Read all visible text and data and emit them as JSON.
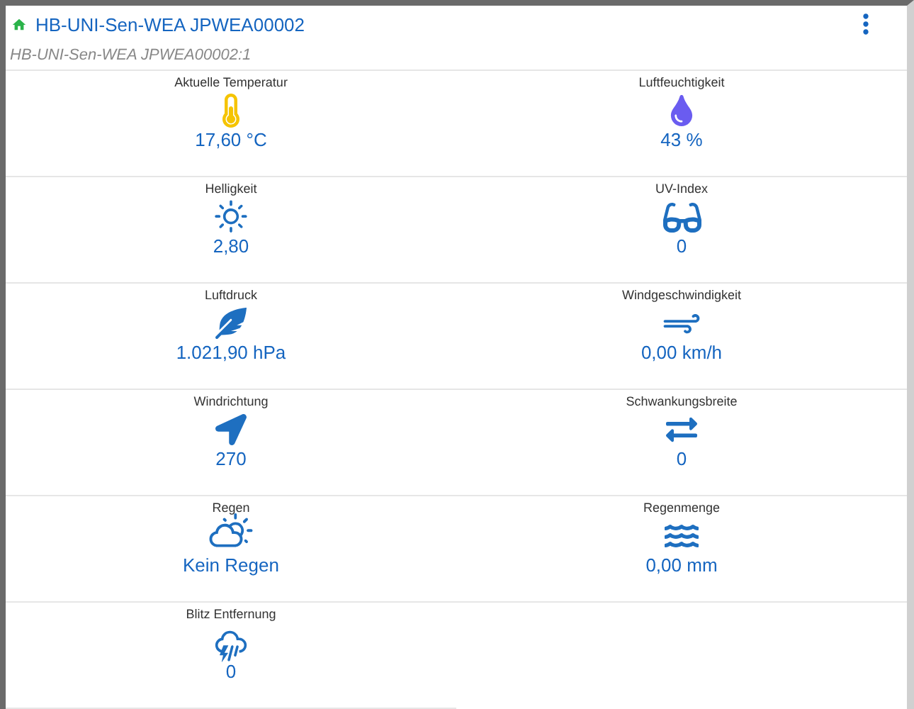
{
  "header": {
    "title": "HB-UNI-Sen-WEA JPWEA00002",
    "subtitle": "HB-UNI-Sen-WEA JPWEA00002:1"
  },
  "tiles": [
    {
      "label": "Aktuelle Temperatur",
      "value": "17,60 °C"
    },
    {
      "label": "Luftfeuchtigkeit",
      "value": "43 %"
    },
    {
      "label": "Helligkeit",
      "value": "2,80"
    },
    {
      "label": "UV-Index",
      "value": "0"
    },
    {
      "label": "Luftdruck",
      "value": "1.021,90 hPa"
    },
    {
      "label": "Windgeschwindigkeit",
      "value": "0,00 km/h"
    },
    {
      "label": "Windrichtung",
      "value": "270"
    },
    {
      "label": "Schwankungsbreite",
      "value": "0"
    },
    {
      "label": "Regen",
      "value": "Kein Regen"
    },
    {
      "label": "Regenmenge",
      "value": "0,00 mm"
    },
    {
      "label": "Blitz Entfernung",
      "value": "0"
    }
  ]
}
